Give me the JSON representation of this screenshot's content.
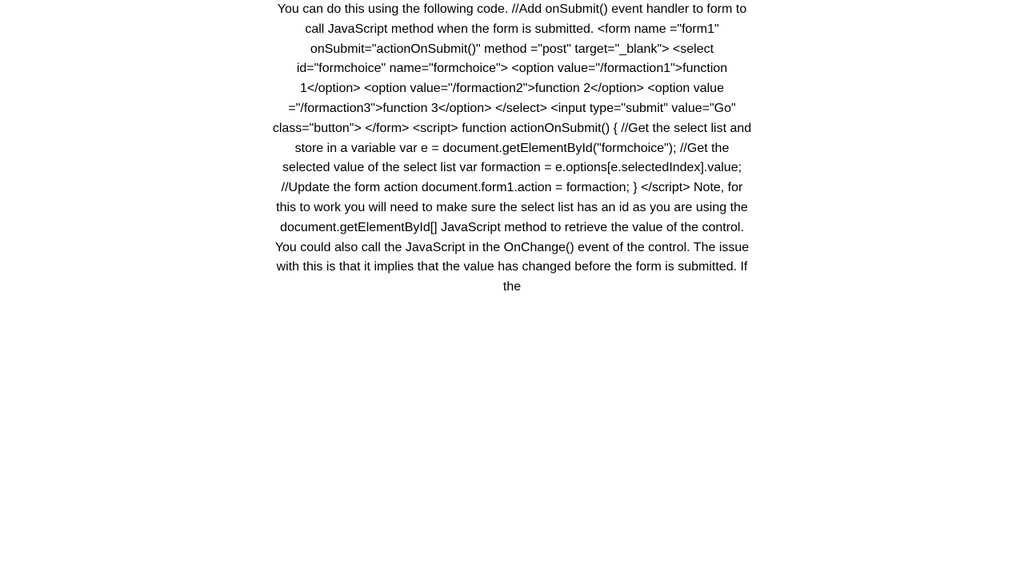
{
  "content": {
    "text": "You can do this using the following code. //Add onSubmit() event handler to form to call JavaScript method when the form is submitted. <form name =\"form1\" onSubmit=\"actionOnSubmit()\" method =\"post\" target=\"_blank\">  <select id=\"formchoice\" name=\"formchoice\"> <option value=\"/formaction1\">function 1</option> <option value=\"/formaction2\">function 2</option> <option value =\"/formaction3\">function 3</option>  </select> <input type=\"submit\" value=\"Go\" class=\"button\">  </form>   <script>  function actionOnSubmit() {  //Get the select list and store in a variable var e = document.getElementById(\"formchoice\"); //Get the selected value of the select list var formaction = e.options[e.selectedIndex].value; //Update the form action document.form1.action = formaction;  }  </script>  Note, for this to work you will need to make sure the select list has an id as you are using the document.getElementById[] JavaScript method to retrieve the value of the control. You could also call the JavaScript in the OnChange() event of the control. The issue with this is that it implies that the value has changed before the form is submitted. If the"
  }
}
